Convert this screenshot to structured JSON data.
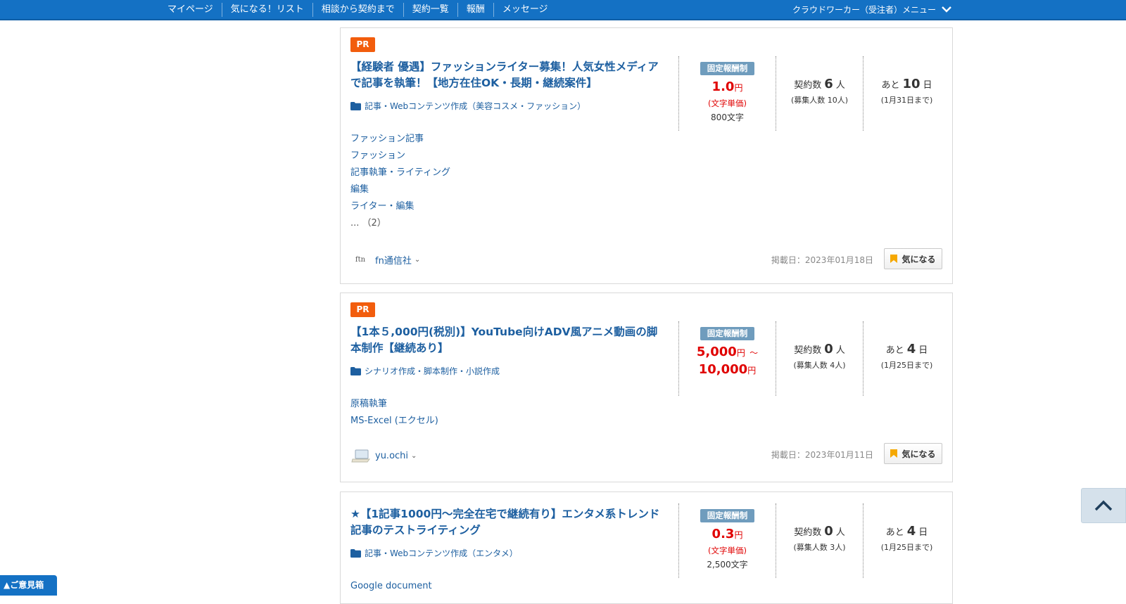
{
  "nav": {
    "items": [
      "マイページ",
      "気になる！リスト",
      "相談から契約まで",
      "契約一覧",
      "報酬",
      "メッセージ"
    ],
    "menu_label": "クラウドワーカー（受注者）メニュー"
  },
  "jobs": [
    {
      "pr": "PR",
      "title": "【経験者 優遇】ファッションライター募集！人気女性メディアで記事を執筆！【地方在住OK・長期・継続案件】",
      "category": "記事・Webコンテンツ作成（美容コスメ・ファッション）",
      "tags": [
        "ファッション記事",
        "ファッション",
        "記事執筆・ライティング",
        "編集",
        "ライター・編集"
      ],
      "tags_more": "... （2）",
      "badge": "固定報酬制",
      "price_value": "1.0",
      "price_unit": "円",
      "price_note": "(文字単価)",
      "word_count": "800文字",
      "contracts_label": "契約数",
      "contracts": "6",
      "contracts_unit": "人",
      "recruit": "(募集人数 10人)",
      "remaining_label": "あと",
      "remaining": "10",
      "remaining_unit": "日",
      "deadline": "(1月31日まで)",
      "client": "fn通信社",
      "client_logo": "ftn",
      "posted": "掲載日：2023年01月18日",
      "fav": "気になる"
    },
    {
      "pr": "PR",
      "title": "【1本５,000円(税別)】YouTube向けADV風アニメ動画の脚本制作【継続あり】",
      "category": "シナリオ作成・脚本制作・小説作成",
      "tags": [
        "原稿執筆",
        "MS-Excel (エクセル)"
      ],
      "badge": "固定報酬制",
      "price_min": "5,000",
      "price_max": "10,000",
      "price_unit": "円",
      "price_sep": "〜",
      "contracts_label": "契約数",
      "contracts": "0",
      "contracts_unit": "人",
      "recruit": "(募集人数 4人)",
      "remaining_label": "あと",
      "remaining": "4",
      "remaining_unit": "日",
      "deadline": "(1月25日まで)",
      "client": "yu.ochi",
      "posted": "掲載日：2023年01月11日",
      "fav": "気になる"
    },
    {
      "title": "★【1記事1000円〜完全在宅で継続有り】エンタメ系トレンド記事のテストライティング",
      "category": "記事・Webコンテンツ作成（エンタメ）",
      "tags": [
        "Google document"
      ],
      "badge": "固定報酬制",
      "price_value": "0.3",
      "price_unit": "円",
      "price_note": "(文字単価)",
      "word_count": "2,500文字",
      "contracts_label": "契約数",
      "contracts": "0",
      "contracts_unit": "人",
      "recruit": "(募集人数 3人)",
      "remaining_label": "あと",
      "remaining": "4",
      "remaining_unit": "日",
      "deadline": "(1月25日まで)"
    }
  ],
  "feedback": "▲ご意見箱",
  "colors": {
    "nav_bg": "#1471c4",
    "link": "#1d5fa0",
    "price": "#e00000",
    "pr": "#f25d0d",
    "badge": "#6f9cbd",
    "bookmark": "#f5a800"
  }
}
